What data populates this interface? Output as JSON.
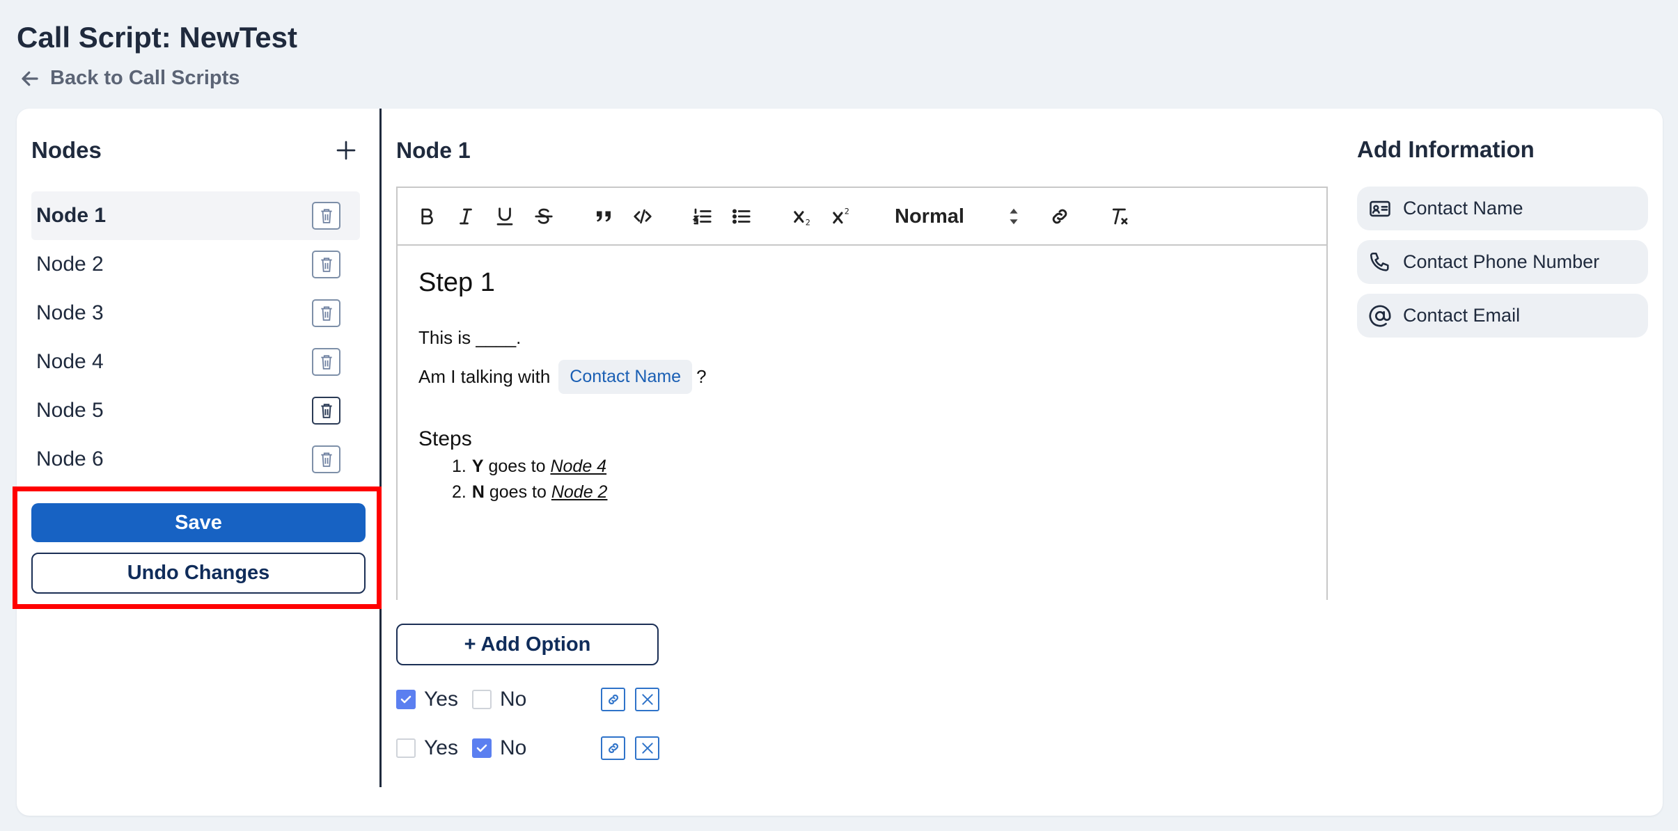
{
  "header": {
    "title": "Call Script: NewTest",
    "back_label": "Back to Call Scripts"
  },
  "nodes_panel": {
    "title": "Nodes",
    "items": [
      {
        "label": "Node 1"
      },
      {
        "label": "Node 2"
      },
      {
        "label": "Node 3"
      },
      {
        "label": "Node 4"
      },
      {
        "label": "Node 5"
      },
      {
        "label": "Node 6"
      }
    ],
    "save_label": "Save",
    "undo_label": "Undo Changes"
  },
  "editor": {
    "title": "Node 1",
    "toolbar": {
      "format_value": "Normal"
    },
    "content": {
      "heading": "Step 1",
      "line1": "This is ____.",
      "line2_prefix": "Am I talking with",
      "line2_chip": "Contact Name",
      "line2_suffix": "?",
      "steps_heading": "Steps",
      "steps": [
        {
          "num": "1.",
          "key": "Y",
          "text": " goes to ",
          "link": "Node 4"
        },
        {
          "num": "2.",
          "key": "N",
          "text": " goes to ",
          "link": "Node 2"
        }
      ]
    },
    "add_option_label": "+ Add Option",
    "options": [
      {
        "yes_label": "Yes",
        "no_label": "No",
        "yes_checked": true,
        "no_checked": false
      },
      {
        "yes_label": "Yes",
        "no_label": "No",
        "yes_checked": false,
        "no_checked": true
      }
    ]
  },
  "info_panel": {
    "title": "Add Information",
    "items": [
      {
        "label": "Contact Name",
        "icon": "contact-card-icon"
      },
      {
        "label": "Contact Phone Number",
        "icon": "phone-icon"
      },
      {
        "label": "Contact Email",
        "icon": "at-sign-icon"
      }
    ]
  },
  "colors": {
    "primary": "#1762c3",
    "highlight": "#ff0000",
    "checkbox": "#5b7ff0"
  }
}
